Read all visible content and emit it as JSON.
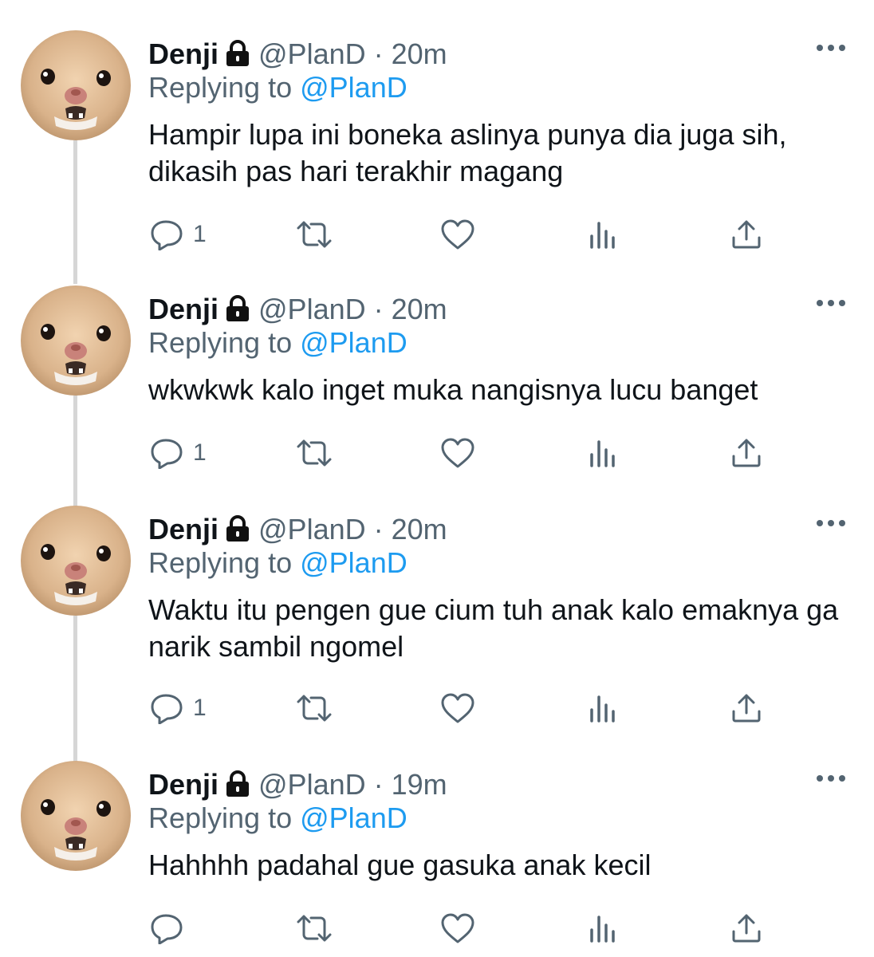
{
  "colors": {
    "accent": "#1d9bf0",
    "secondary_text": "#536471",
    "primary_text": "#0f1419",
    "thread_line": "#d6d6d6"
  },
  "tweets": [
    {
      "name": "Denji",
      "handle": "@PlanD",
      "separator": "·",
      "time": "20m",
      "replying_prefix": "Replying to",
      "replying_to": "@PlanD",
      "text": "Hampir lupa ini boneka aslinya punya dia juga sih, dikasih pas hari terakhir magang",
      "reply_count": "1"
    },
    {
      "name": "Denji",
      "handle": "@PlanD",
      "separator": "·",
      "time": "20m",
      "replying_prefix": "Replying to",
      "replying_to": "@PlanD",
      "text": "wkwkwk kalo inget muka nangisnya lucu banget",
      "reply_count": "1"
    },
    {
      "name": "Denji",
      "handle": "@PlanD",
      "separator": "·",
      "time": "20m",
      "replying_prefix": "Replying to",
      "replying_to": "@PlanD",
      "text": "Waktu itu pengen gue cium tuh anak kalo emaknya ga narik sambil ngomel",
      "reply_count": "1"
    },
    {
      "name": "Denji",
      "handle": "@PlanD",
      "separator": "·",
      "time": "19m",
      "replying_prefix": "Replying to",
      "replying_to": "@PlanD",
      "text": "Hahhhh padahal gue gasuka anak kecil",
      "reply_count": ""
    }
  ],
  "icons": {
    "avatar": "crying-cat-avatar",
    "lock": "lock-icon",
    "more": "more-options-icon",
    "reply": "reply-icon",
    "retweet": "retweet-icon",
    "like": "like-icon",
    "views": "views-icon",
    "share": "share-icon"
  }
}
